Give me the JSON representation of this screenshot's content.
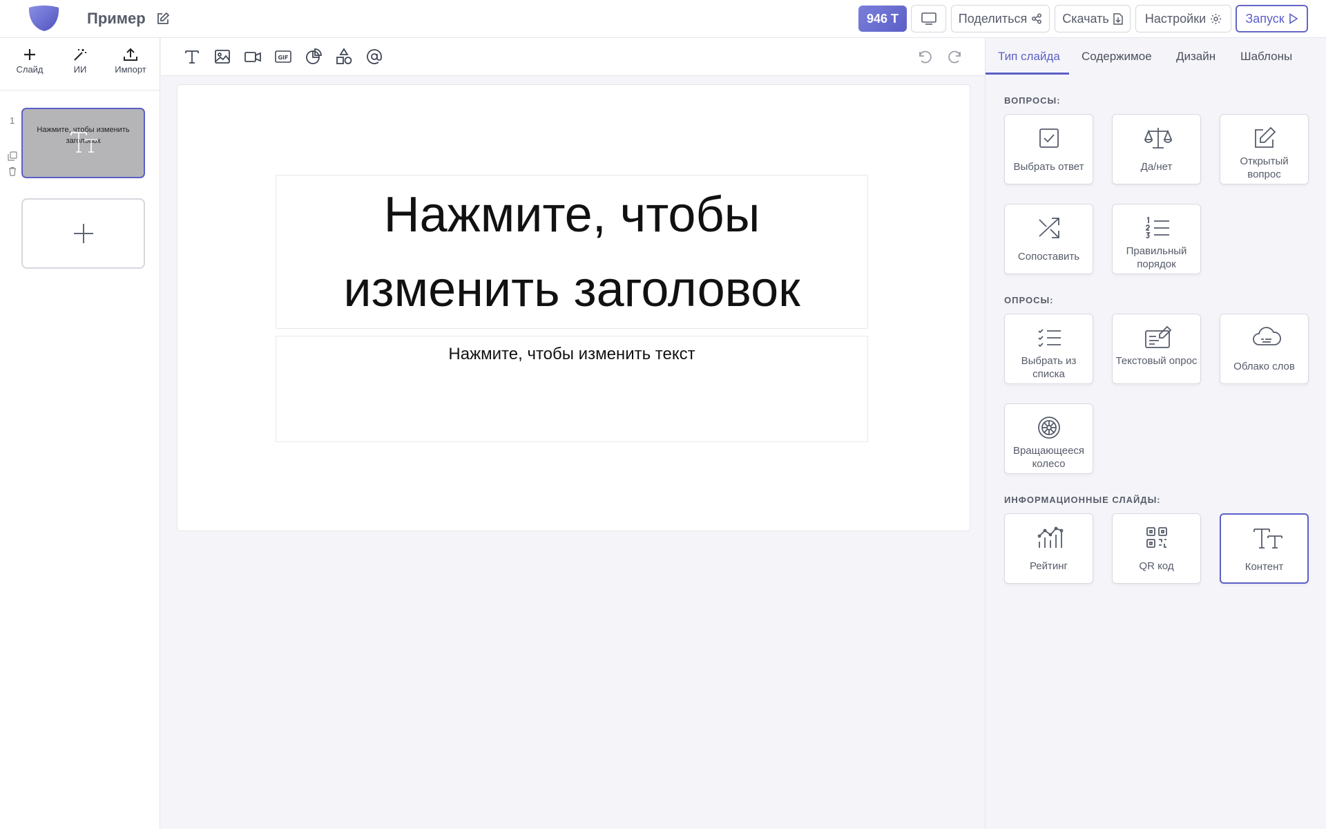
{
  "header": {
    "title": "Пример",
    "tokens": "946 T",
    "share_label": "Поделиться",
    "download_label": "Скачать",
    "settings_label": "Настройки",
    "launch_label": "Запуск"
  },
  "left_panel": {
    "tools": [
      {
        "label": "Слайд",
        "icon": "plus-icon"
      },
      {
        "label": "ИИ",
        "icon": "magic-wand-icon"
      },
      {
        "label": "Импорт",
        "icon": "upload-icon"
      }
    ],
    "slides": [
      {
        "number": "1",
        "title": "Нажмите, чтобы изменить заголовок"
      }
    ]
  },
  "editor_toolbar": {
    "icons": [
      "text-icon",
      "image-icon",
      "video-icon",
      "gif-icon",
      "chart-icon",
      "shapes-icon",
      "mention-icon",
      "undo-icon",
      "redo-icon"
    ]
  },
  "canvas": {
    "title": "Нажмите, чтобы изменить заголовок",
    "text": "Нажмите, чтобы изменить текст"
  },
  "right_panel": {
    "tabs": [
      "Тип слайда",
      "Содержимое",
      "Дизайн",
      "Шаблоны"
    ],
    "active_tab": "Тип слайда",
    "sections": {
      "questions": {
        "label": "ВОПРОСЫ:",
        "items": [
          "Выбрать ответ",
          "Да/нет",
          "Открытый вопрос",
          "Сопоставить",
          "Правильный порядок"
        ]
      },
      "polls": {
        "label": "ОПРОСЫ:",
        "items": [
          "Выбрать из списка",
          "Текстовый опрос",
          "Облако слов",
          "Вращающееся колесо"
        ]
      },
      "info": {
        "label": "ИНФОРМАЦИОННЫЕ СЛАЙДЫ:",
        "items": [
          "Рейтинг",
          "QR код",
          "Контент"
        ]
      }
    },
    "selected_type": "Контент"
  },
  "colors": {
    "accent": "#5b5fc7",
    "background": "#f5f5f9",
    "text": "#555b69"
  }
}
